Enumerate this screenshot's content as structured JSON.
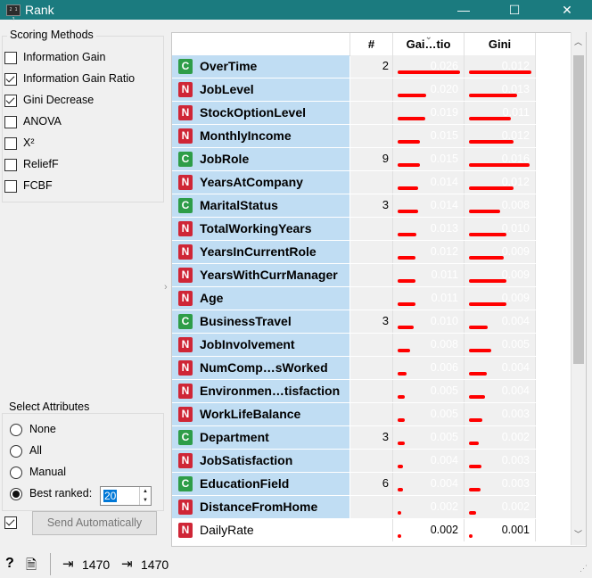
{
  "window": {
    "title": "Rank",
    "minimize": "—",
    "maximize": "☐",
    "close": "✕",
    "icon_text": "2 1 3"
  },
  "scoring": {
    "title": "Scoring Methods",
    "methods": [
      {
        "label": "Information Gain",
        "checked": false
      },
      {
        "label": "Information Gain Ratio",
        "checked": true
      },
      {
        "label": "Gini Decrease",
        "checked": true
      },
      {
        "label": "ANOVA",
        "checked": false
      },
      {
        "label": "X²",
        "checked": false
      },
      {
        "label": "ReliefF",
        "checked": false
      },
      {
        "label": "FCBF",
        "checked": false
      }
    ]
  },
  "select": {
    "title": "Select Attributes",
    "options": [
      {
        "label": "None",
        "selected": false
      },
      {
        "label": "All",
        "selected": false
      },
      {
        "label": "Manual",
        "selected": false
      },
      {
        "label": "Best ranked:",
        "selected": true
      }
    ],
    "best_n": "20"
  },
  "send": {
    "label": "Send Automatically",
    "auto_checked": true
  },
  "table": {
    "headers": [
      "#",
      "Gai…tio",
      "Gini"
    ],
    "rows": [
      {
        "type": "C",
        "name": "OverTime",
        "count": "2",
        "gain": "0.026",
        "gini": "0.012",
        "gain_frac": 1.0,
        "gini_frac": 1.0,
        "sel": true
      },
      {
        "type": "N",
        "name": "JobLevel",
        "count": "",
        "gain": "0.020",
        "gini": "0.013",
        "gain_frac": 0.46,
        "gini_frac": 0.77,
        "sel": true
      },
      {
        "type": "N",
        "name": "StockOptionLevel",
        "count": "",
        "gain": "0.019",
        "gini": "0.011",
        "gain_frac": 0.44,
        "gini_frac": 0.67,
        "sel": true
      },
      {
        "type": "N",
        "name": "MonthlyIncome",
        "count": "",
        "gain": "0.015",
        "gini": "0.012",
        "gain_frac": 0.35,
        "gini_frac": 0.72,
        "sel": true
      },
      {
        "type": "C",
        "name": "JobRole",
        "count": "9",
        "gain": "0.015",
        "gini": "0.016",
        "gain_frac": 0.35,
        "gini_frac": 0.97,
        "sel": true
      },
      {
        "type": "N",
        "name": "YearsAtCompany",
        "count": "",
        "gain": "0.014",
        "gini": "0.012",
        "gain_frac": 0.33,
        "gini_frac": 0.72,
        "sel": true
      },
      {
        "type": "C",
        "name": "MaritalStatus",
        "count": "3",
        "gain": "0.014",
        "gini": "0.008",
        "gain_frac": 0.33,
        "gini_frac": 0.5,
        "sel": true
      },
      {
        "type": "N",
        "name": "TotalWorkingYears",
        "count": "",
        "gain": "0.013",
        "gini": "0.010",
        "gain_frac": 0.3,
        "gini_frac": 0.6,
        "sel": true
      },
      {
        "type": "N",
        "name": "YearsInCurrentRole",
        "count": "",
        "gain": "0.012",
        "gini": "0.009",
        "gain_frac": 0.28,
        "gini_frac": 0.55,
        "sel": true
      },
      {
        "type": "N",
        "name": "YearsWithCurrManager",
        "count": "",
        "gain": "0.011",
        "gini": "0.009",
        "gain_frac": 0.28,
        "gini_frac": 0.6,
        "sel": true
      },
      {
        "type": "N",
        "name": "Age",
        "count": "",
        "gain": "0.011",
        "gini": "0.009",
        "gain_frac": 0.28,
        "gini_frac": 0.6,
        "sel": true
      },
      {
        "type": "C",
        "name": "BusinessTravel",
        "count": "3",
        "gain": "0.010",
        "gini": "0.004",
        "gain_frac": 0.25,
        "gini_frac": 0.3,
        "sel": true
      },
      {
        "type": "N",
        "name": "JobInvolvement",
        "count": "",
        "gain": "0.008",
        "gini": "0.005",
        "gain_frac": 0.2,
        "gini_frac": 0.35,
        "sel": true
      },
      {
        "type": "N",
        "name": "NumComp…sWorked",
        "count": "",
        "gain": "0.006",
        "gini": "0.004",
        "gain_frac": 0.14,
        "gini_frac": 0.28,
        "sel": true
      },
      {
        "type": "N",
        "name": "Environmen…tisfaction",
        "count": "",
        "gain": "0.005",
        "gini": "0.004",
        "gain_frac": 0.12,
        "gini_frac": 0.25,
        "sel": true
      },
      {
        "type": "N",
        "name": "WorkLifeBalance",
        "count": "",
        "gain": "0.005",
        "gini": "0.003",
        "gain_frac": 0.12,
        "gini_frac": 0.22,
        "sel": true
      },
      {
        "type": "C",
        "name": "Department",
        "count": "3",
        "gain": "0.005",
        "gini": "0.002",
        "gain_frac": 0.12,
        "gini_frac": 0.15,
        "sel": true
      },
      {
        "type": "N",
        "name": "JobSatisfaction",
        "count": "",
        "gain": "0.004",
        "gini": "0.003",
        "gain_frac": 0.09,
        "gini_frac": 0.2,
        "sel": true
      },
      {
        "type": "C",
        "name": "EducationField",
        "count": "6",
        "gain": "0.004",
        "gini": "0.003",
        "gain_frac": 0.09,
        "gini_frac": 0.18,
        "sel": true
      },
      {
        "type": "N",
        "name": "DistanceFromHome",
        "count": "",
        "gain": "0.002",
        "gini": "0.002",
        "gain_frac": 0.06,
        "gini_frac": 0.12,
        "sel": true
      },
      {
        "type": "N",
        "name": "DailyRate",
        "count": "",
        "gain": "0.002",
        "gini": "0.001",
        "gain_frac": 0.05,
        "gini_frac": 0.06,
        "sel": false
      }
    ]
  },
  "status": {
    "input_count": "1470",
    "output_count": "1470",
    "help": "?",
    "doc": "🗎",
    "in_icon": "⇥",
    "out_icon": "⇥"
  },
  "colors": {
    "titlebar": "#1b7b7f",
    "selection": "#c0ddf3",
    "bar": "#ff0000",
    "numeric_badge": "#cf2636",
    "categorical_badge": "#2e9d48"
  }
}
